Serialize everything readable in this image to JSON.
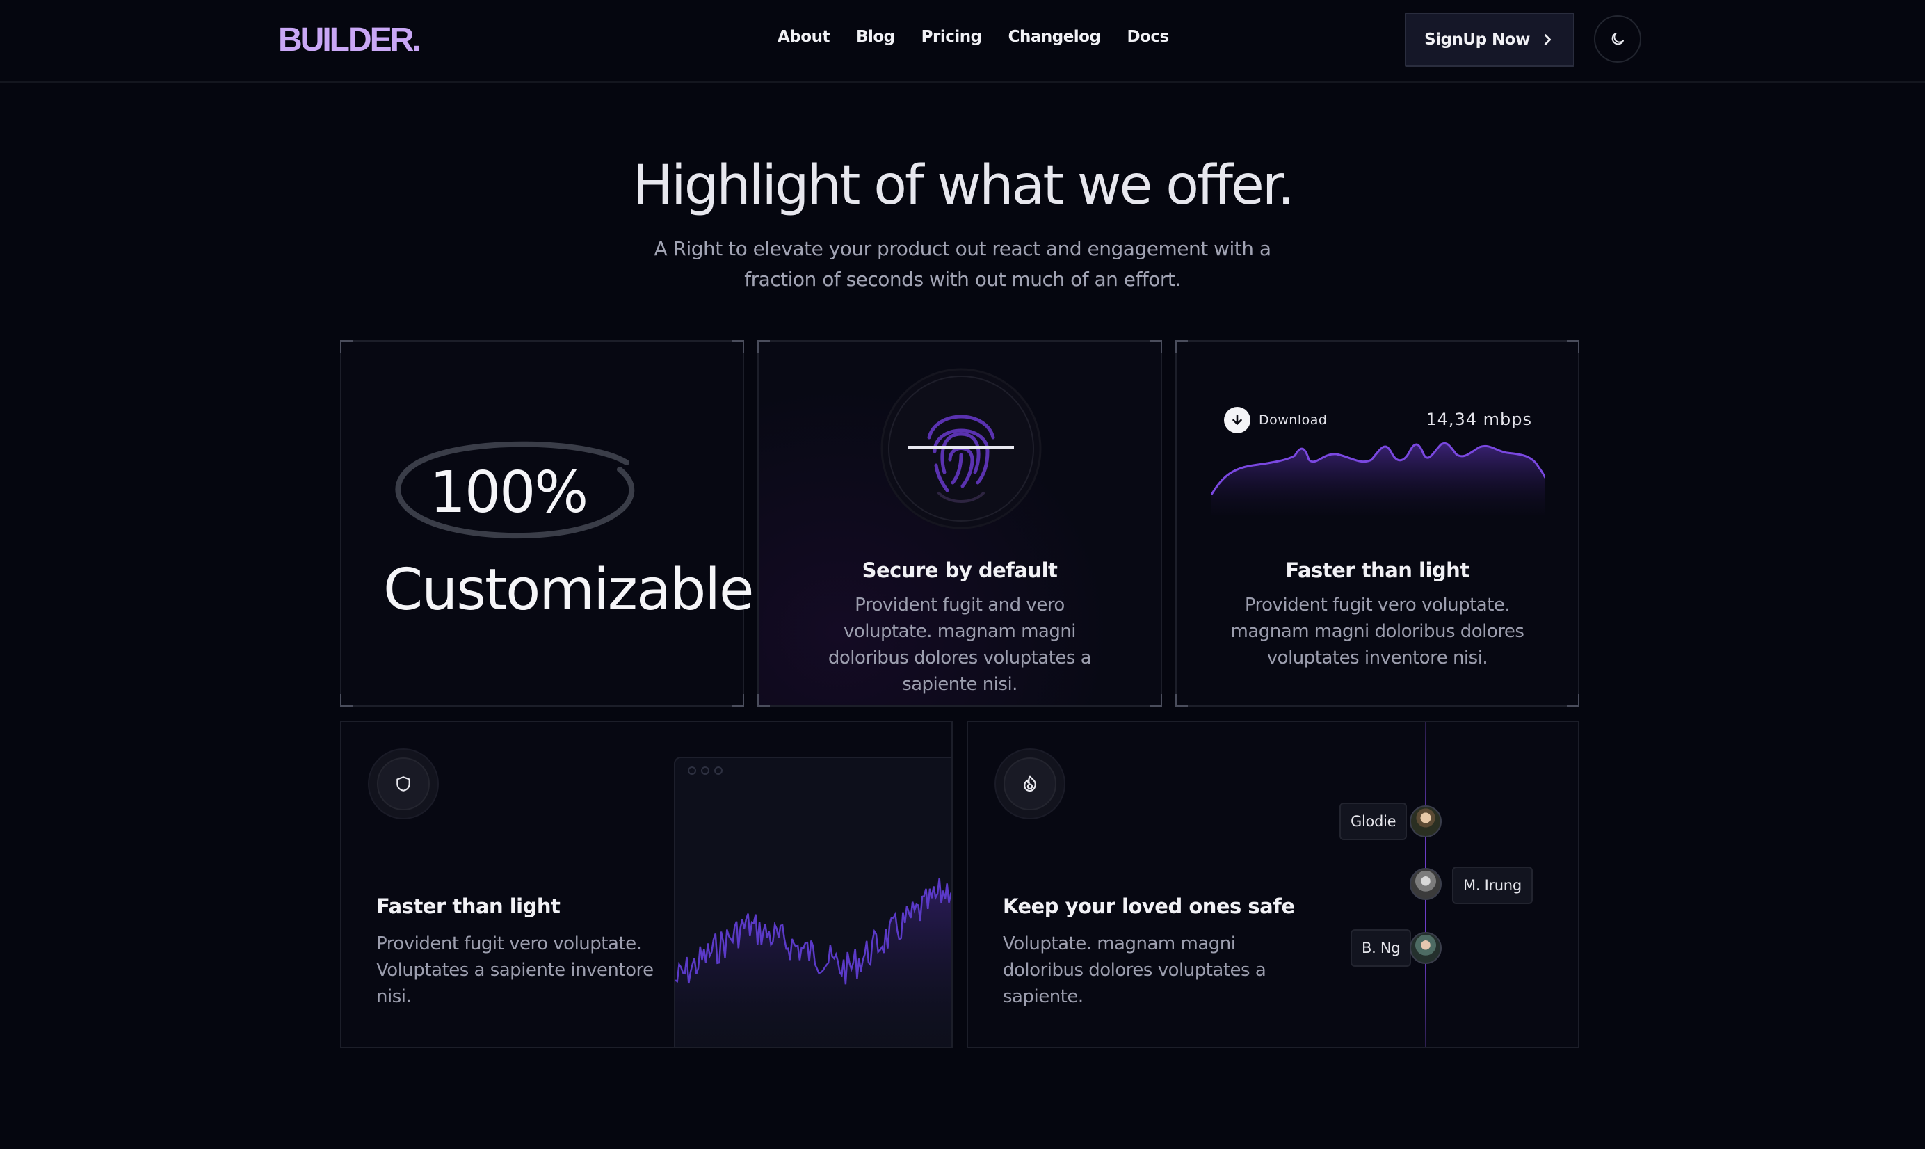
{
  "header": {
    "logo": "BUILDER.",
    "nav": [
      "About",
      "Blog",
      "Pricing",
      "Changelog",
      "Docs"
    ],
    "signup_label": "SignUp Now",
    "theme_icon": "moon-icon"
  },
  "hero": {
    "title": "Highlight of what we offer.",
    "subtitle": "A Right to elevate your product out react and engagement with a fraction of seconds with out much of an effort."
  },
  "cards": {
    "customizable": {
      "percent": "100%",
      "label": "Customizable"
    },
    "secure": {
      "title": "Secure by default",
      "text": "Provident fugit and vero voluptate. magnam magni doloribus dolores voluptates a sapiente nisi.",
      "icon": "fingerprint-icon"
    },
    "speed": {
      "download_label": "Download",
      "speed_value": "14,34 mbps",
      "title": "Faster than light",
      "text": "Provident fugit vero voluptate. magnam magni doloribus dolores voluptates inventore nisi."
    },
    "faster": {
      "title": "Faster than light",
      "text": "Provident fugit vero voluptate. Voluptates a sapiente inventore nisi.",
      "icon": "shield-icon"
    },
    "safe": {
      "title": "Keep your loved ones safe",
      "text": "Voluptate. magnam magni doloribus dolores voluptates a sapiente.",
      "icon": "fire-icon",
      "people": [
        "Glodie",
        "M. Irung",
        "B. Ng"
      ]
    }
  },
  "colors": {
    "accent": "#c9a7f5",
    "purple": "#6b3cc6",
    "background": "#05060f"
  }
}
